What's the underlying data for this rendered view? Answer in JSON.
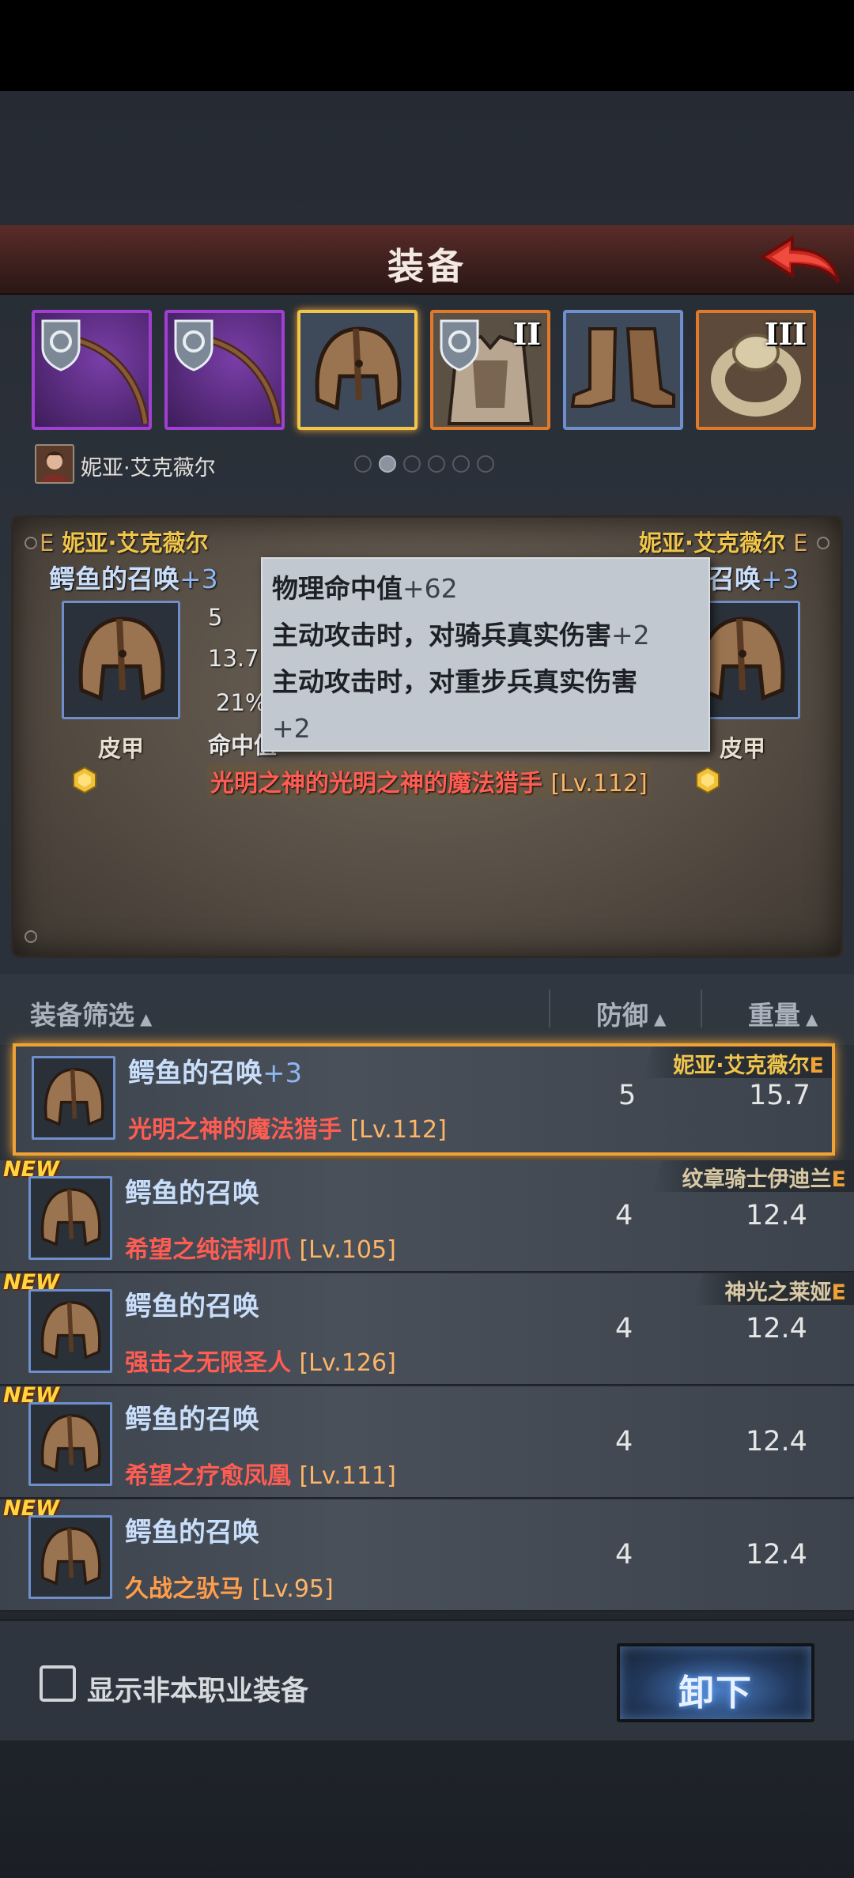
{
  "header": {
    "title": "装备",
    "back_icon": "back-arrow-icon"
  },
  "slots": [
    {
      "icon": "bow-icon",
      "rarity_color": "#a03fd0",
      "locked": true,
      "tier": ""
    },
    {
      "icon": "bow-icon",
      "rarity_color": "#a03fd0",
      "locked": true,
      "tier": ""
    },
    {
      "icon": "helmet-icon",
      "rarity_color": "#d8a83a",
      "locked": false,
      "tier": "",
      "selected": true
    },
    {
      "icon": "armor-icon",
      "rarity_color": "#e07a2a",
      "locked": true,
      "tier": "II"
    },
    {
      "icon": "boots-icon",
      "rarity_color": "#6f8fcc",
      "locked": false,
      "tier": ""
    },
    {
      "icon": "ring-icon",
      "rarity_color": "#e07a2a",
      "locked": false,
      "tier": "III"
    }
  ],
  "character": {
    "name": "妮亚·艾克薇尔",
    "page_index": 1,
    "page_count": 6
  },
  "compare": {
    "left": {
      "owner": "妮亚·艾克薇尔",
      "grade": "E",
      "item_name": "鳄鱼的召唤",
      "enhance": "+3",
      "type": "皮甲",
      "stat1": "5",
      "stat2": "13.7",
      "stat3": "21%",
      "stat_label": "命中值"
    },
    "right": {
      "owner": "妮亚·艾克薇尔",
      "grade": "E",
      "item_name": "召唤",
      "enhance": "+3",
      "type": "皮甲"
    },
    "set_name": "光明之神的光明之神的魔法猎手",
    "set_level": "[Lv.112]",
    "tooltip": [
      {
        "text": "物理命中值",
        "value": "+62"
      },
      {
        "text": "主动攻击时，对骑兵真实伤害",
        "value": "+2"
      },
      {
        "text": "主动攻击时，对重步兵真实伤害",
        "value": ""
      },
      {
        "text": "",
        "value": "+2"
      }
    ]
  },
  "list_header": {
    "filter": "装备筛选",
    "defense": "防御",
    "weight": "重量",
    "sort_icon": "sort-triangle-icon"
  },
  "items": [
    {
      "name": "鳄鱼的召唤",
      "enhance": "+3",
      "set": "光明之神的魔法猎手",
      "level": "[Lv.112]",
      "defense": "5",
      "weight": "15.7",
      "owner": "妮亚·艾克薇尔",
      "grade": "E",
      "new": false,
      "selected": true,
      "set_color": "red"
    },
    {
      "name": "鳄鱼的召唤",
      "enhance": "",
      "set": "希望之纯洁利爪",
      "level": "[Lv.105]",
      "defense": "4",
      "weight": "12.4",
      "owner": "纹章骑士伊迪兰",
      "grade": "E",
      "new": true,
      "selected": false,
      "set_color": "red"
    },
    {
      "name": "鳄鱼的召唤",
      "enhance": "",
      "set": "强击之无限圣人",
      "level": "[Lv.126]",
      "defense": "4",
      "weight": "12.4",
      "owner": "神光之莱娅",
      "grade": "E",
      "new": true,
      "selected": false,
      "set_color": "red"
    },
    {
      "name": "鳄鱼的召唤",
      "enhance": "",
      "set": "希望之疗愈凤凰",
      "level": "[Lv.111]",
      "defense": "4",
      "weight": "12.4",
      "owner": "",
      "grade": "",
      "new": true,
      "selected": false,
      "set_color": "red"
    },
    {
      "name": "鳄鱼的召唤",
      "enhance": "",
      "set": "久战之驮马",
      "level": "[Lv.95]",
      "defense": "4",
      "weight": "12.4",
      "owner": "",
      "grade": "",
      "new": true,
      "selected": false,
      "set_color": "orange"
    }
  ],
  "new_badge": "NEW",
  "footer": {
    "show_other_class": "显示非本职业装备",
    "checked": false,
    "unequip": "卸下"
  }
}
